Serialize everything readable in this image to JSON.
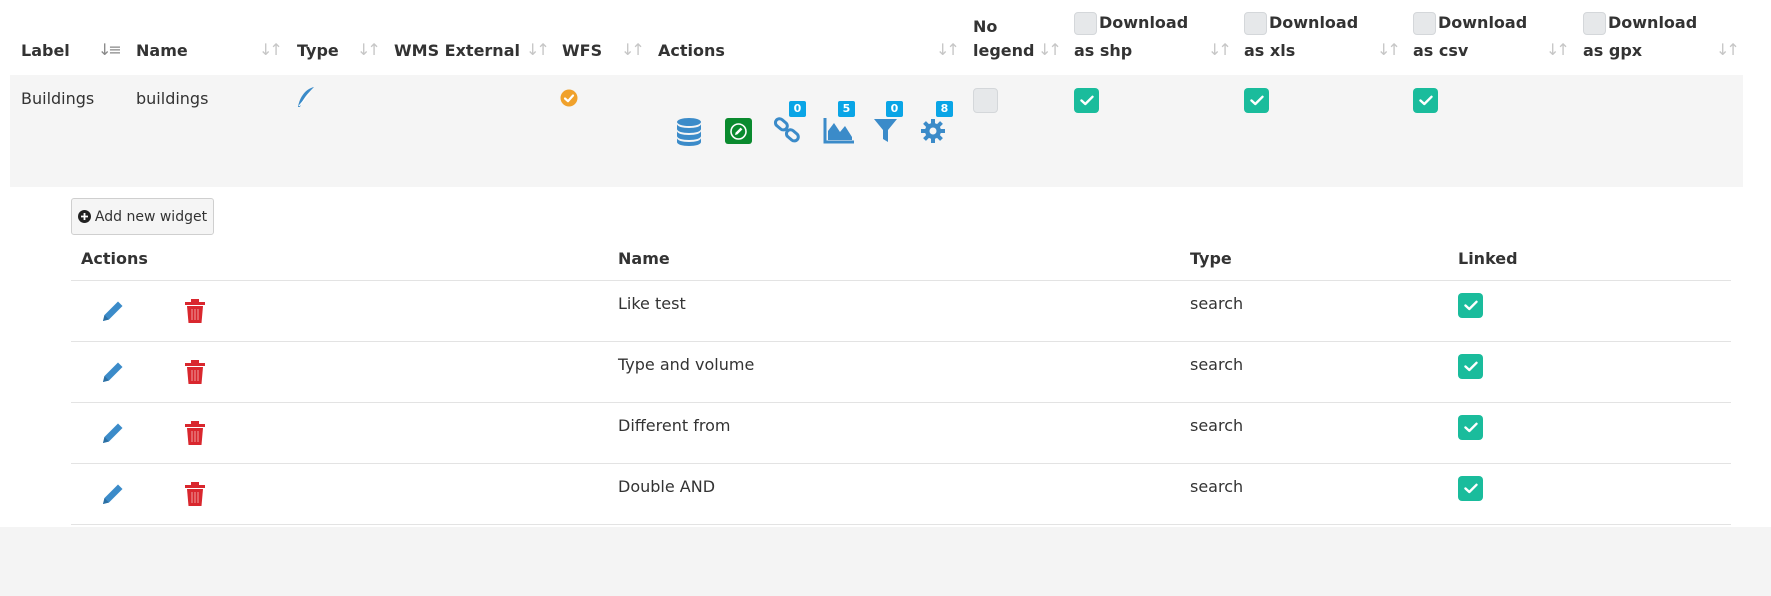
{
  "layers_table": {
    "headers": {
      "label": "Label",
      "name": "Name",
      "type": "Type",
      "wms_external": "WMS External",
      "wfs": "WFS",
      "actions": "Actions",
      "no_legend_1": "No",
      "no_legend_2": "legend",
      "download_shp_1": "Download",
      "download_shp_2": "as shp",
      "download_xls_1": "Download",
      "download_xls_2": "as xls",
      "download_csv_1": "Download",
      "download_csv_2": "as csv",
      "download_gpx_1": "Download",
      "download_gpx_2": "as gpx"
    },
    "row": {
      "label": "Buildings",
      "name": "buildings",
      "type_icon": "feather-icon",
      "wfs_icon": "check-circle-icon",
      "badges": {
        "relations": "0",
        "widgets": "5",
        "constraints": "0",
        "settings": "8"
      },
      "no_legend": false,
      "download_shp": true,
      "download_xls": true,
      "download_csv": true
    }
  },
  "widgets": {
    "add_button_label": "Add new widget",
    "headers": {
      "actions": "Actions",
      "name": "Name",
      "type": "Type",
      "linked": "Linked"
    },
    "rows": [
      {
        "name": "Like test",
        "type": "search",
        "linked": true
      },
      {
        "name": "Type and volume",
        "type": "search",
        "linked": true
      },
      {
        "name": "Different from",
        "type": "search",
        "linked": true
      },
      {
        "name": "Double AND",
        "type": "search",
        "linked": true
      }
    ]
  },
  "colors": {
    "accent": "#1abc9c",
    "edit_blue": "#3b8bc9",
    "delete_red": "#d9272e",
    "wfs_orange": "#f0a12b",
    "badge_blue": "#0aa5e6",
    "editing_green": "#0a8a2e"
  }
}
